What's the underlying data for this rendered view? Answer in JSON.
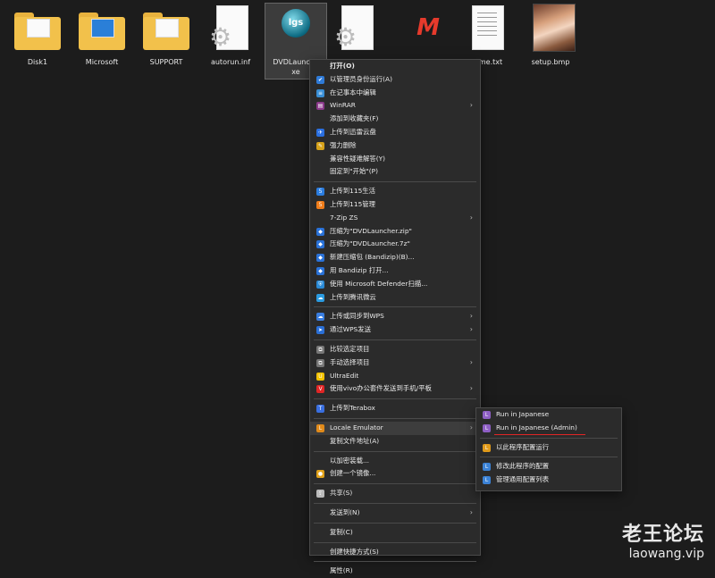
{
  "desktop": {
    "files": [
      {
        "name": "Disk1",
        "type": "folder"
      },
      {
        "name": "Microsoft",
        "type": "folder"
      },
      {
        "name": "SUPPORT",
        "type": "folder"
      },
      {
        "name": "autorun.inf",
        "type": "settings-file"
      },
      {
        "name": "DVDLauncher.exe",
        "label_line1": "DVDLaunche",
        "label_line2": "xe",
        "type": "exe",
        "icon_text": "lgs",
        "selected": true
      },
      {
        "name": "",
        "type": "settings-file"
      },
      {
        "name": "",
        "type": "app-m"
      },
      {
        "name": "adme.txt",
        "type": "text-file"
      },
      {
        "name": "setup.bmp",
        "type": "image"
      }
    ]
  },
  "context_menu": {
    "items": [
      {
        "label": "打开(O)",
        "icon": "",
        "bold": true
      },
      {
        "label": "以管理员身份运行(A)",
        "icon": "shield-icon"
      },
      {
        "label": "在记事本中编辑",
        "icon": "notepad-icon"
      },
      {
        "label": "WinRAR",
        "icon": "winrar-icon",
        "submenu": true
      },
      {
        "label": "添加到收藏夹(F)",
        "icon": ""
      },
      {
        "label": "上传到迅雷云盘",
        "icon": "thunder-icon"
      },
      {
        "label": "强力删除",
        "icon": "delete-icon"
      },
      {
        "label": "兼容性疑难解答(Y)",
        "icon": ""
      },
      {
        "label": "固定到\"开始\"(P)",
        "icon": ""
      },
      {
        "sep": true
      },
      {
        "label": "上传到115生活",
        "icon": "115-life-icon"
      },
      {
        "label": "上传到115管理",
        "icon": "115-manage-icon"
      },
      {
        "label": "7-Zip ZS",
        "icon": "",
        "submenu": true
      },
      {
        "label": "压缩为\"DVDLauncher.zip\"",
        "icon": "bandizip-icon"
      },
      {
        "label": "压缩为\"DVDLauncher.7z\"",
        "icon": "bandizip-icon"
      },
      {
        "label": "新建压缩包 (Bandizip)(B)...",
        "icon": "bandizip-icon"
      },
      {
        "label": "用 Bandizip 打开...",
        "icon": "bandizip-icon"
      },
      {
        "label": "使用 Microsoft Defender扫描...",
        "icon": "defender-icon"
      },
      {
        "label": "上传到腾讯微云",
        "icon": "weiyun-icon"
      },
      {
        "sep": true
      },
      {
        "label": "上传或同步到WPS",
        "icon": "wps-cloud-icon",
        "submenu": true
      },
      {
        "label": "通过WPS发送",
        "icon": "wps-send-icon",
        "submenu": true
      },
      {
        "sep": true
      },
      {
        "label": "比较选定项目",
        "icon": "compare-icon"
      },
      {
        "label": "手动选择项目",
        "icon": "select-icon",
        "submenu": true
      },
      {
        "label": "UltraEdit",
        "icon": "ultraedit-icon"
      },
      {
        "label": "使用vivo办公套件发送到手机/平板",
        "icon": "vivo-icon",
        "submenu": true
      },
      {
        "sep": true
      },
      {
        "label": "上传到Terabox",
        "icon": "terabox-icon"
      },
      {
        "sep": true
      },
      {
        "label": "Locale Emulator",
        "icon": "locale-emulator-icon",
        "submenu": true,
        "hover": true
      },
      {
        "label": "复制文件地址(A)",
        "icon": ""
      },
      {
        "sep": true
      },
      {
        "label": "以加密装载...",
        "icon": ""
      },
      {
        "label": "创建一个镜像...",
        "icon": "disc-icon"
      },
      {
        "sep": true
      },
      {
        "label": "共享(S)",
        "icon": "share-icon"
      },
      {
        "sep": true
      },
      {
        "label": "发送到(N)",
        "icon": "",
        "submenu": true
      },
      {
        "sep": true
      },
      {
        "label": "复制(C)",
        "icon": ""
      },
      {
        "sep": true
      },
      {
        "label": "创建快捷方式(S)",
        "icon": ""
      },
      {
        "sep": true
      },
      {
        "label": "属性(R)",
        "icon": ""
      }
    ]
  },
  "submenu": {
    "items": [
      {
        "label": "Run in Japanese",
        "icon": "le-purple-icon"
      },
      {
        "label": "Run in Japanese (Admin)",
        "icon": "le-purple-icon",
        "underline": true
      },
      {
        "sep": true
      },
      {
        "label": "以此程序配置运行",
        "icon": "le-orange-icon"
      },
      {
        "sep": true
      },
      {
        "label": "修改此程序的配置",
        "icon": "le-blue-icon"
      },
      {
        "label": "管理通用配置列表",
        "icon": "le-blue-icon"
      }
    ]
  },
  "watermark": {
    "title": "老王论坛",
    "subtitle": "laowang.vip"
  },
  "colors": {
    "le-purple-icon": "#8e5fc4",
    "le-orange-icon": "#e09a1a",
    "le-blue-icon": "#3b82d6",
    "shield-icon": "#2f7bd8",
    "notepad-icon": "#3a8fd6",
    "winrar-icon": "#8b3a8b",
    "thunder-icon": "#2a6fe0",
    "delete-icon": "#d6a21a",
    "115-life-icon": "#2b7de0",
    "115-manage-icon": "#f07d1a",
    "bandizip-icon": "#2a72d8",
    "defender-icon": "#2a8ad6",
    "weiyun-icon": "#2b9be0",
    "wps-cloud-icon": "#3a7ee0",
    "wps-send-icon": "#2a6fd6",
    "compare-icon": "#777777",
    "select-icon": "#777777",
    "ultraedit-icon": "#f2c200",
    "vivo-icon": "#e02525",
    "terabox-icon": "#3a6fe0",
    "locale-emulator-icon": "#e08a1a",
    "disc-icon": "#e0a11a",
    "share-icon": "#bbbbbb"
  }
}
